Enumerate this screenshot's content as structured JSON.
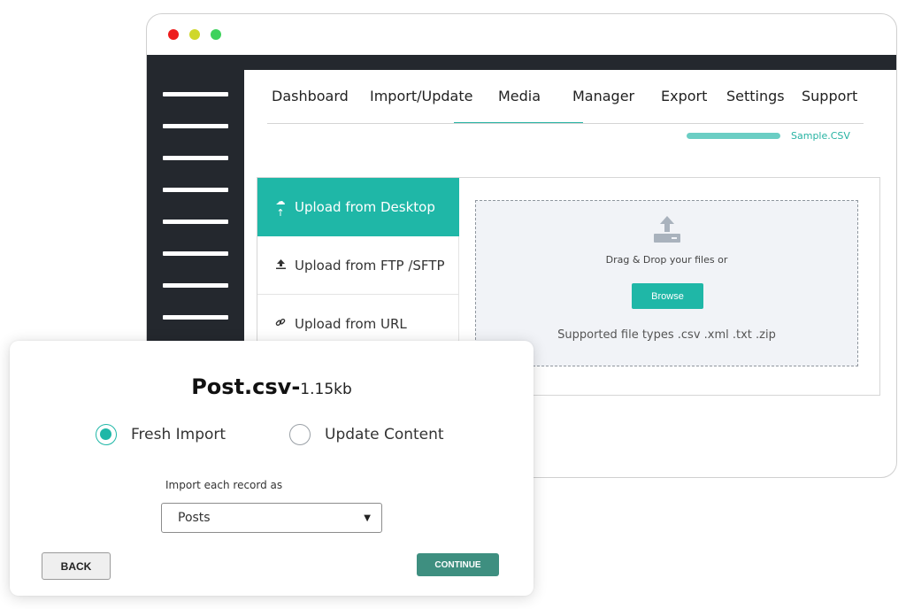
{
  "window": {
    "controls": [
      "close",
      "minimize",
      "maximize"
    ]
  },
  "nav": {
    "tabs": [
      {
        "label": "Dashboard"
      },
      {
        "label": "Import/Update",
        "active": true
      },
      {
        "label": "Media"
      },
      {
        "label": "Manager"
      },
      {
        "label": "Export"
      },
      {
        "label": "Settings"
      },
      {
        "label": "Support"
      }
    ]
  },
  "upload_progress": {
    "file_name": "Sample.CSV",
    "progress": 1.0
  },
  "upload": {
    "options": [
      {
        "label": "Upload from Desktop",
        "icon": "cloud-upload-icon",
        "active": true
      },
      {
        "label": "Upload from FTP /SFTP",
        "icon": "upload-icon"
      },
      {
        "label": "Upload from URL",
        "icon": "link-icon"
      }
    ],
    "dropzone": {
      "icon": "upload-tray-icon",
      "text": "Drag & Drop your files or",
      "browse_label": "Browse",
      "supported_types": "Supported file types .csv .xml .txt .zip"
    }
  },
  "modal": {
    "file_name": "Post.csv-",
    "file_size": "1.15kb",
    "import_modes": [
      {
        "label": "Fresh Import",
        "checked": true
      },
      {
        "label": "Update Content",
        "checked": false
      }
    ],
    "record_label": "Import each record as",
    "record_value": "Posts",
    "back_label": "BACK",
    "continue_label": "CONTINUE"
  },
  "colors": {
    "accent": "#1fb7a7",
    "sidebar": "#24282e",
    "continue": "#3e8f80"
  }
}
